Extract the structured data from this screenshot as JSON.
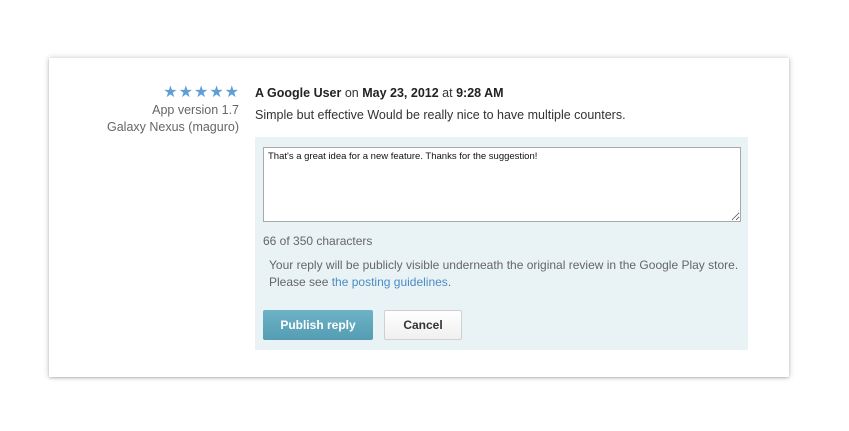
{
  "review": {
    "rating": 5,
    "stars": [
      "★",
      "★",
      "★",
      "★",
      "★"
    ],
    "app_version": "App version 1.7",
    "device": "Galaxy Nexus (maguro)",
    "author": "A Google User",
    "on_label": "on",
    "date": "May 23, 2012",
    "at_label": "at",
    "time": "9:28 AM",
    "text": "Simple but effective Would be really nice to have multiple counters."
  },
  "reply": {
    "value": "That's a great idea for a new feature. Thanks for the suggestion!",
    "char_count": "66 of 350 characters",
    "notice_prefix": "Your reply will be publicly visible underneath the original review in the Google Play store. Please see",
    "guidelines_link": "the posting guidelines",
    "notice_suffix": ".",
    "publish_label": "Publish reply",
    "cancel_label": "Cancel"
  },
  "colors": {
    "star": "#5f9ed8",
    "reply_background": "#e9f2f5",
    "publish_button": "#5fa7bc",
    "link": "#4a8cc4"
  }
}
